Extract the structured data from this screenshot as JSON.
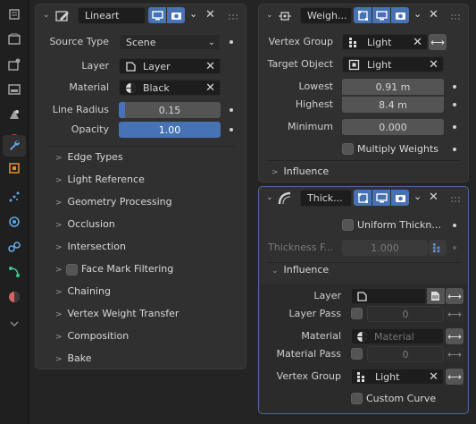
{
  "tabs": [
    {
      "name": "tool-tab",
      "icon": "tool-icon"
    },
    {
      "name": "render-tab",
      "icon": "render-icon"
    },
    {
      "name": "output-tab",
      "icon": "output-icon"
    },
    {
      "name": "view-layer-tab",
      "icon": "view-layer-icon"
    },
    {
      "name": "scene-tab",
      "icon": "scene-icon"
    },
    {
      "name": "world-tab",
      "icon": "world-icon"
    },
    {
      "name": "object-tab",
      "icon": "object-icon"
    },
    {
      "name": "modifier-tab",
      "icon": "wrench-icon",
      "active": true
    },
    {
      "name": "particles-tab",
      "icon": "particles-icon"
    },
    {
      "name": "physics-tab",
      "icon": "physics-icon"
    },
    {
      "name": "constraints-tab",
      "icon": "constraints-icon"
    },
    {
      "name": "data-tab",
      "icon": "data-icon"
    },
    {
      "name": "material-tab",
      "icon": "material-icon"
    },
    {
      "name": "more-tab",
      "icon": "chevron-down-icon"
    }
  ],
  "lineart": {
    "name": "Lineart",
    "source_type_label": "Source Type",
    "source_type_value": "Scene",
    "layer_label": "Layer",
    "layer_value": "Layer",
    "material_label": "Material",
    "material_value": "Black",
    "line_radius_label": "Line Radius",
    "line_radius_value": "0.15",
    "line_radius_fill": 0.06,
    "opacity_label": "Opacity",
    "opacity_value": "1.00",
    "opacity_fill": 1.0,
    "sections": {
      "edge_types": "Edge Types",
      "light_reference": "Light Reference",
      "geometry_processing": "Geometry Processing",
      "occlusion": "Occlusion",
      "intersection": "Intersection",
      "face_mark_filtering": "Face Mark Filtering",
      "chaining": "Chaining",
      "vertex_weight_transfer": "Vertex Weight Transfer",
      "composition": "Composition",
      "bake": "Bake"
    }
  },
  "weight": {
    "name": "Weigh...",
    "vertex_group_label": "Vertex Group",
    "vertex_group_value": "Light",
    "target_object_label": "Target Object",
    "target_object_value": "Light",
    "lowest_label": "Lowest",
    "lowest_value": "0.91 m",
    "highest_label": "Highest",
    "highest_value": "8.4 m",
    "minimum_label": "Minimum",
    "minimum_value": "0.000",
    "multiply_label": "Multiply Weights",
    "influence_label": "Influence"
  },
  "thickness": {
    "name": "Thick...",
    "uniform_label": "Uniform Thickn...",
    "thickness_factor_label": "Thickness F...",
    "thickness_factor_value": "1.000",
    "influence_label": "Influence",
    "layer_label": "Layer",
    "layer_value": "",
    "layer_pass_label": "Layer Pass",
    "layer_pass_value": "0",
    "material_label": "Material",
    "material_placeholder": "Material",
    "material_pass_label": "Material Pass",
    "material_pass_value": "0",
    "vertex_group_label": "Vertex Group",
    "vertex_group_value": "Light",
    "custom_curve_label": "Custom Curve"
  },
  "colors": {
    "accent": "#4772b3",
    "panel": "#303030",
    "field": "#545454"
  }
}
